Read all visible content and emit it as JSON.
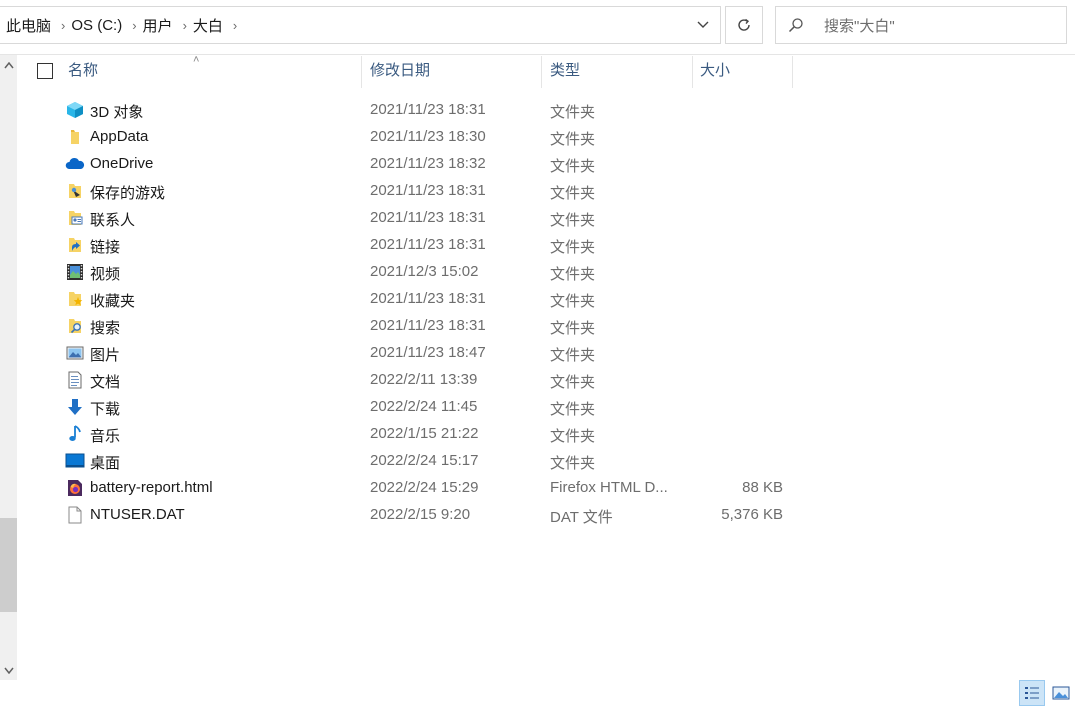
{
  "breadcrumb": [
    "此电脑",
    "OS (C:)",
    "用户",
    "大白"
  ],
  "search": {
    "placeholder": "搜索\"大白\""
  },
  "columns": {
    "name": "名称",
    "date": "修改日期",
    "type": "类型",
    "size": "大小"
  },
  "files": [
    {
      "name": "3D 对象",
      "date": "2021/11/23 18:31",
      "type": "文件夹",
      "size": "",
      "icon": "3d-objects-folder-icon"
    },
    {
      "name": "AppData",
      "date": "2021/11/23 18:30",
      "type": "文件夹",
      "size": "",
      "icon": "folder-icon"
    },
    {
      "name": "OneDrive",
      "date": "2021/11/23 18:32",
      "type": "文件夹",
      "size": "",
      "icon": "onedrive-cloud-icon"
    },
    {
      "name": "保存的游戏",
      "date": "2021/11/23 18:31",
      "type": "文件夹",
      "size": "",
      "icon": "saved-games-folder-icon"
    },
    {
      "name": "联系人",
      "date": "2021/11/23 18:31",
      "type": "文件夹",
      "size": "",
      "icon": "contacts-folder-icon"
    },
    {
      "name": "链接",
      "date": "2021/11/23 18:31",
      "type": "文件夹",
      "size": "",
      "icon": "links-folder-icon"
    },
    {
      "name": "视频",
      "date": "2021/12/3 15:02",
      "type": "文件夹",
      "size": "",
      "icon": "videos-film-icon"
    },
    {
      "name": "收藏夹",
      "date": "2021/11/23 18:31",
      "type": "文件夹",
      "size": "",
      "icon": "favorites-folder-icon"
    },
    {
      "name": "搜索",
      "date": "2021/11/23 18:31",
      "type": "文件夹",
      "size": "",
      "icon": "searches-folder-icon"
    },
    {
      "name": "图片",
      "date": "2021/11/23 18:47",
      "type": "文件夹",
      "size": "",
      "icon": "pictures-icon"
    },
    {
      "name": "文档",
      "date": "2022/2/11 13:39",
      "type": "文件夹",
      "size": "",
      "icon": "documents-icon"
    },
    {
      "name": "下载",
      "date": "2022/2/24 11:45",
      "type": "文件夹",
      "size": "",
      "icon": "downloads-arrow-icon"
    },
    {
      "name": "音乐",
      "date": "2022/1/15 21:22",
      "type": "文件夹",
      "size": "",
      "icon": "music-note-icon"
    },
    {
      "name": "桌面",
      "date": "2022/2/24 15:17",
      "type": "文件夹",
      "size": "",
      "icon": "desktop-icon"
    },
    {
      "name": "battery-report.html",
      "date": "2022/2/24 15:29",
      "type": "Firefox HTML D...",
      "size": "88 KB",
      "icon": "firefox-html-file-icon"
    },
    {
      "name": "NTUSER.DAT",
      "date": "2022/2/15 9:20",
      "type": "DAT 文件",
      "size": "5,376 KB",
      "icon": "blank-file-icon"
    }
  ],
  "colors": {
    "header_text": "#3a5a80",
    "folder_yellow": "#f2c94c",
    "accent_blue": "#0078d4"
  }
}
